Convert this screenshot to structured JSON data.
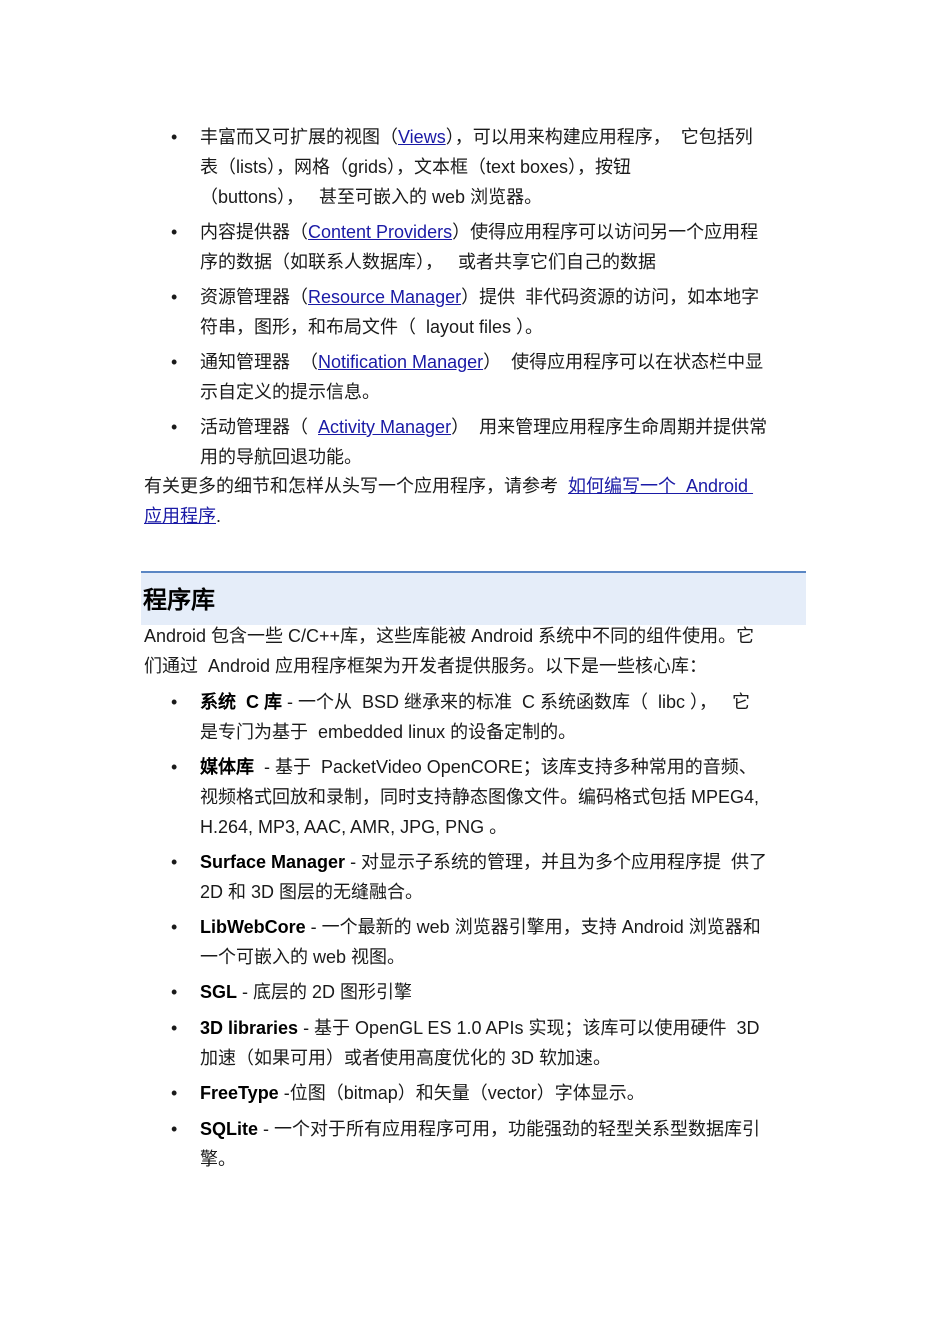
{
  "framework_list": [
    {
      "lines": [
        [
          {
            "t": "丰富而又可扩展的视图（"
          },
          {
            "link": "Views"
          },
          {
            "t": "），可以用来构建应用程序，  它包括列"
          }
        ],
        [
          {
            "t": "表（lists），网格（grids），文本框（text boxes），按钮"
          }
        ],
        [
          {
            "t": "（buttons），   甚至可嵌入的 web 浏览器。"
          }
        ]
      ]
    },
    {
      "lines": [
        [
          {
            "t": "内容提供器（"
          },
          {
            "link": "Content Providers"
          },
          {
            "t": "）使得应用程序可以访问另一个应用程"
          }
        ],
        [
          {
            "t": "序的数据（如联系人数据库），   或者共享它们自己的数据"
          }
        ]
      ]
    },
    {
      "lines": [
        [
          {
            "t": "资源管理器（"
          },
          {
            "link": "Resource Manager"
          },
          {
            "t": "）提供  非代码资源的访问，如本地字"
          }
        ],
        [
          {
            "t": "符串，图形，和布局文件（  layout files ）。"
          }
        ]
      ]
    },
    {
      "lines": [
        [
          {
            "t": "通知管理器  （"
          },
          {
            "link": "Notification Manager"
          },
          {
            "t": "）  使得应用程序可以在状态栏中显"
          }
        ],
        [
          {
            "t": "示自定义的提示信息。"
          }
        ]
      ]
    },
    {
      "lines": [
        [
          {
            "t": "活动管理器（  "
          },
          {
            "link": "Activity Manager"
          },
          {
            "t": "）  用来管理应用程序生命周期并提供常"
          }
        ],
        [
          {
            "t": "用的导航回退功能。"
          }
        ]
      ]
    }
  ],
  "more_paragraph": [
    [
      {
        "t": "有关更多的细节和怎样从头写一个应用程序，请参考  "
      },
      {
        "link": "如何编写一个  Android "
      }
    ],
    [
      {
        "link": "应用程序"
      },
      {
        "t": "."
      }
    ]
  ],
  "section": {
    "heading": "程序库",
    "intro": [
      [
        {
          "t": "Android 包含一些 C/C++库，这些库能被 Android 系统中不同的组件使用。它"
        }
      ],
      [
        {
          "t": "们通过  Android 应用程序框架为开发者提供服务。以下是一些核心库："
        }
      ]
    ],
    "libraries": [
      {
        "lines": [
          [
            {
              "b": "系统  C 库"
            },
            {
              "t": " - 一个从  BSD 继承来的标准  C 系统函数库（  libc ），   它"
            }
          ],
          [
            {
              "t": "是专门为基于  embedded linux 的设备定制的。"
            }
          ]
        ]
      },
      {
        "lines": [
          [
            {
              "b": "媒体库"
            },
            {
              "t": "  - 基于  PacketVideo OpenCORE；该库支持多种常用的音频、"
            }
          ],
          [
            {
              "t": "视频格式回放和录制，同时支持静态图像文件。编码格式包括 MPEG4,"
            }
          ],
          [
            {
              "t": "H.264, MP3, AAC, AMR, JPG, PNG 。"
            }
          ]
        ]
      },
      {
        "lines": [
          [
            {
              "b": "Surface Manager"
            },
            {
              "t": " - 对显示子系统的管理，并且为多个应用程序提  供了"
            }
          ],
          [
            {
              "t": "2D 和 3D 图层的无缝融合。"
            }
          ]
        ]
      },
      {
        "lines": [
          [
            {
              "b": "LibWebCore"
            },
            {
              "t": " - 一个最新的 web 浏览器引擎用，支持 Android 浏览器和"
            }
          ],
          [
            {
              "t": "一个可嵌入的 web 视图。"
            }
          ]
        ]
      },
      {
        "lines": [
          [
            {
              "b": "SGL"
            },
            {
              "t": " - 底层的 2D 图形引擎"
            }
          ]
        ]
      },
      {
        "lines": [
          [
            {
              "b": "3D libraries"
            },
            {
              "t": " - 基于 OpenGL ES 1.0 APIs 实现；该库可以使用硬件  3D"
            }
          ],
          [
            {
              "t": "加速（如果可用）或者使用高度优化的 3D 软加速。"
            }
          ]
        ]
      },
      {
        "lines": [
          [
            {
              "b": "FreeType"
            },
            {
              "t": " -位图（bitmap）和矢量（vector）字体显示。"
            }
          ]
        ]
      },
      {
        "lines": [
          [
            {
              "b": "SQLite"
            },
            {
              "t": " - 一个对于所有应用程序可用，功能强劲的轻型关系型数据库引"
            }
          ],
          [
            {
              "t": "擎。"
            }
          ]
        ]
      }
    ]
  },
  "bullet_glyph": "•",
  "colors": {
    "link": "#1a1aa6",
    "heading_band": "#e5edf9",
    "heading_rule": "#5a86c4"
  }
}
